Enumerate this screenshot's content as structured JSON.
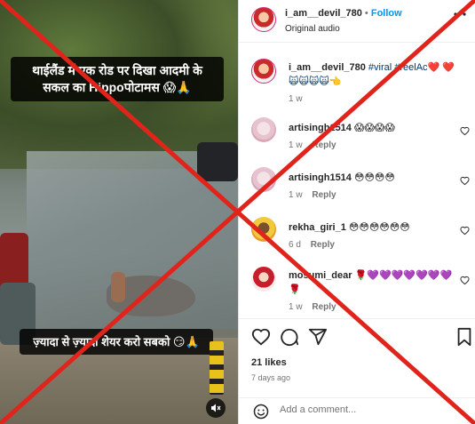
{
  "media": {
    "caption_top": "थाईलैंड में एक रोड पर दिखा आदमी के सकल का Hippoपोटामस 😱🙏",
    "caption_bottom": "ज़्यादा से ज़्यादा शेयर करो सबको 😏🙏",
    "mute_icon": "speaker-muted-icon"
  },
  "post": {
    "author": "i_am__devil_780",
    "separator": "•",
    "follow_label": "Follow",
    "audio": "Original audio",
    "more_icon": "more-horizontal-icon"
  },
  "caption_comment": {
    "username": "i_am__devil_780",
    "text": "#viral #reelAc❤️ ❤️ 🙀🙀🙀🙀👈",
    "time": "1 w"
  },
  "comments": [
    {
      "username": "artisingh1514",
      "text": "😱😱😱😱",
      "time": "1 w",
      "reply_label": "Reply"
    },
    {
      "username": "artisingh1514",
      "text": "😳😳😳😳",
      "time": "1 w",
      "reply_label": "Reply"
    },
    {
      "username": "rekha_giri_1",
      "text": "😳😳😳😳😳😳",
      "time": "6 d",
      "reply_label": "Reply"
    },
    {
      "username": "mosumi_dear",
      "text": "🌹💜💜💜💜💜💜💜🌹",
      "time": "1 w",
      "reply_label": "Reply"
    }
  ],
  "actions": {
    "like_icon": "heart-icon",
    "comment_icon": "comment-icon",
    "share_icon": "paper-plane-icon",
    "save_icon": "bookmark-icon"
  },
  "likes_text": "21 likes",
  "posted_ago": "7 days ago",
  "add_comment": {
    "placeholder": "Add a comment...",
    "emoji_icon": "smiley-icon"
  },
  "colors": {
    "accent_blue": "#0095f6",
    "hashtag": "#00376b",
    "overlay_red": "#e0241b"
  }
}
